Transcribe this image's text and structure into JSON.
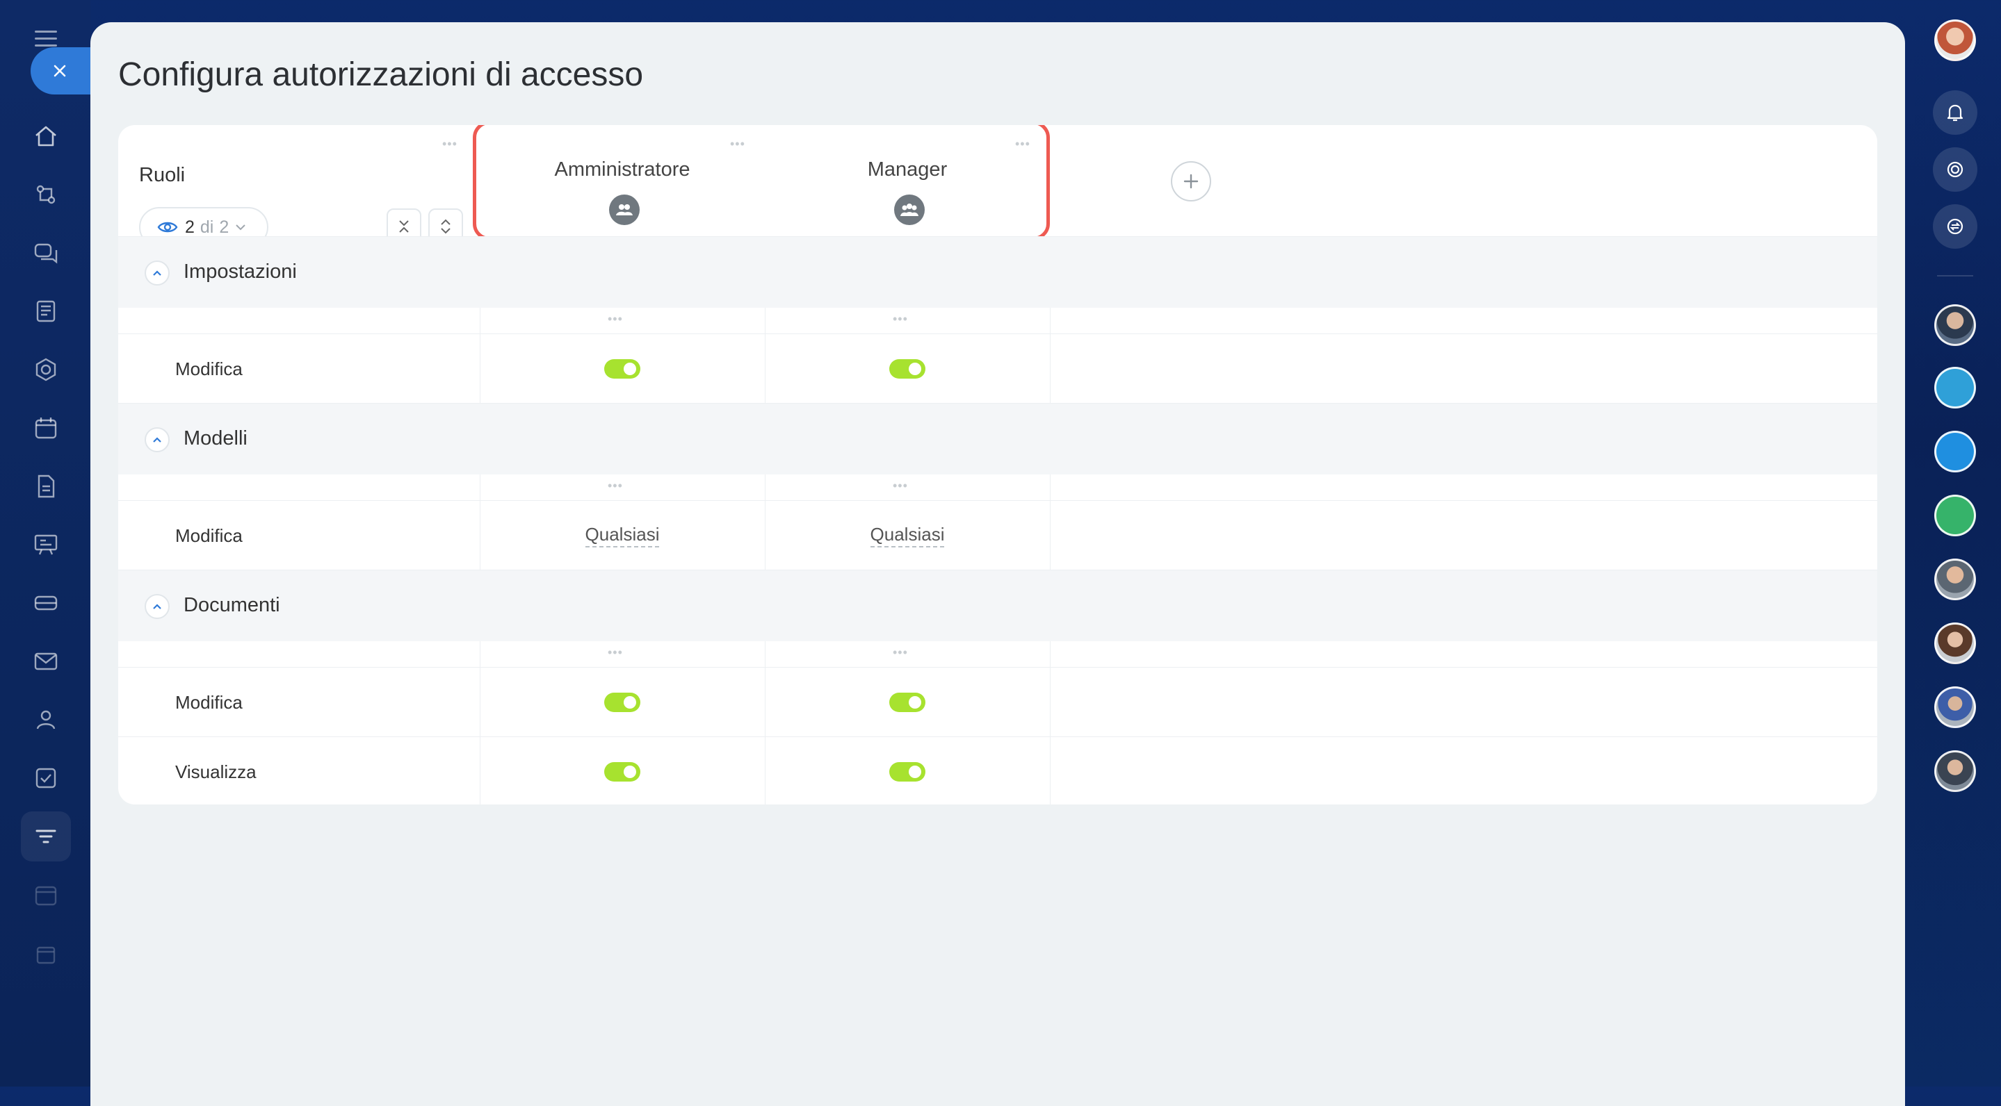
{
  "page": {
    "title": "Configura autorizzazioni di accesso"
  },
  "header": {
    "roles_label": "Ruoli",
    "visible_count": "2",
    "count_of": "di",
    "total_count": "2",
    "dots": "•••"
  },
  "columns": [
    {
      "name": "Amministratore",
      "icon": "group-icon"
    },
    {
      "name": "Manager",
      "icon": "group-icon"
    }
  ],
  "sections": [
    {
      "title": "Impostazioni",
      "rows": [
        {
          "label": "Modifica",
          "type": "switch",
          "values": [
            true,
            true
          ]
        }
      ]
    },
    {
      "title": "Modelli",
      "rows": [
        {
          "label": "Modifica",
          "type": "select",
          "values": [
            "Qualsiasi",
            "Qualsiasi"
          ]
        }
      ]
    },
    {
      "title": "Documenti",
      "rows": [
        {
          "label": "Modifica",
          "type": "switch",
          "values": [
            true,
            true
          ]
        },
        {
          "label": "Visualizza",
          "type": "switch",
          "values": [
            true,
            true
          ]
        }
      ]
    }
  ],
  "colors": {
    "accent": "#2f7ad8",
    "switch_on": "#a7e22f",
    "highlight": "#ee5a52"
  }
}
